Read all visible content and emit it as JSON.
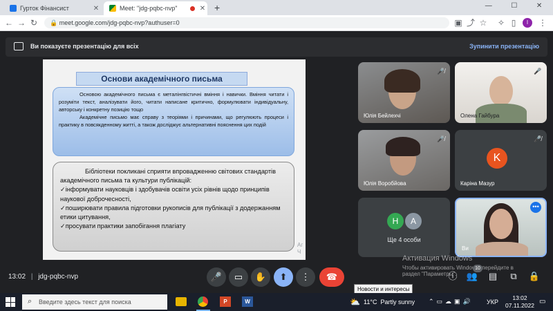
{
  "browser": {
    "tabs": [
      {
        "title": "Гурток Фінансист",
        "active": false
      },
      {
        "title": "Meet: \"jdg-pqbc-nvp\"",
        "active": true
      }
    ],
    "new_tab": "+",
    "url": "meet.google.com/jdg-pqbc-nvp?authuser=0",
    "profile_initial": "I",
    "window_controls": [
      "—",
      "☐",
      "✕"
    ]
  },
  "meet": {
    "banner": {
      "text": "Ви показуєте презентацію для всіх",
      "stop_label": "Зупинити презентацію"
    },
    "slide": {
      "title": "Основи академічного письма",
      "box1_p1": "Основою академічного письма є металінгвістичні вміння і навички. Вміння читати і розуміти текст, аналізувати його, читати написане критично, формулювати індивідуальну, авторську і конкретну позицію тощо",
      "box1_p2": "Академічне письмо має справу з теоріями і причинами, що регулюють процеси і практику в повсякденному житті, а також досліджує альтернативні пояснення цих подій",
      "box2_p1": "Бібліотеки покликані сприяти впровадженню світових стандартів академічного письма та культури публікацій:",
      "box2_items": [
        "інформувати науковців і здобувачів освіти усіх рівнів щодо принципів наукової доброчесності,",
        "поширювати правила підготовки рукописів для публікації з додержанням етики цитування,",
        "просувати практики запобігання плагіату"
      ],
      "corner_text": "Аг\nЧ"
    },
    "participants": [
      {
        "name": "Юлія Бейлехчі",
        "muted": true,
        "type": "video"
      },
      {
        "name": "Олена Гайбура",
        "muted": true,
        "type": "video"
      },
      {
        "name": "Юлія Воробйова",
        "muted": true,
        "type": "video"
      },
      {
        "name": "Каріна Мазур",
        "muted": true,
        "type": "avatar",
        "initial": "K",
        "color": "#e8541f"
      },
      {
        "name": "Ще 4 особи",
        "type": "group",
        "initials": [
          "Н",
          "А"
        ],
        "colors": [
          "#34a853",
          "#8b97a3"
        ]
      },
      {
        "name": "Ви",
        "type": "self"
      }
    ],
    "bottom": {
      "time": "13:02",
      "separator": "|",
      "meeting_code": "jdg-pqbc-nvp",
      "participant_count": "10"
    },
    "activation": {
      "title": "Активация Windows",
      "line1": "Чтобы активировать Windows, перейдите в",
      "line2": "раздел \"Параметры\"."
    },
    "tooltip": "Новости и интересы"
  },
  "taskbar": {
    "search_placeholder": "Введите здесь текст для поиска",
    "weather": "11°C  Partly sunny",
    "language": "УКР",
    "time": "13:02",
    "date": "07.11.2022"
  },
  "colors": {
    "end_call": "#ea4335",
    "present": "#8ab4f8",
    "accent_banner": "#8ab4f8"
  }
}
